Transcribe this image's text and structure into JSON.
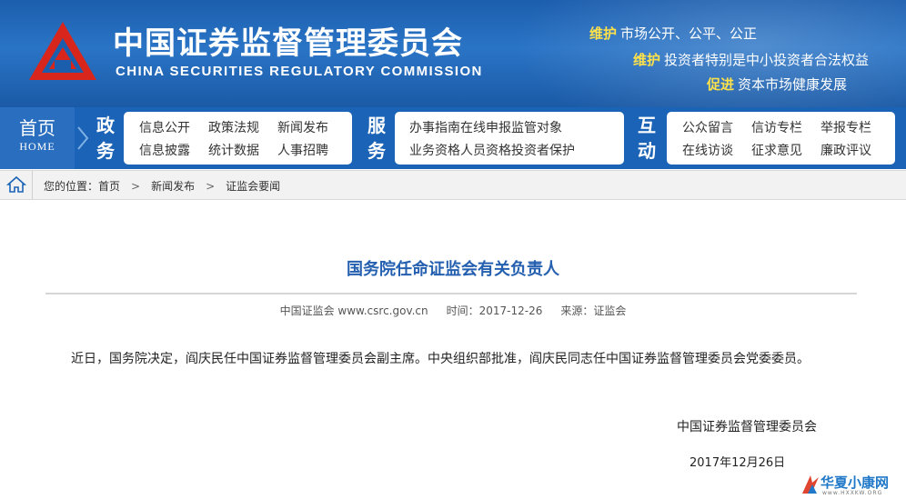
{
  "header": {
    "org_name_cn": "中国证券监督管理委员会",
    "org_name_en": "CHINA SECURITIES REGULATORY COMMISSION",
    "slogans": [
      {
        "highlight": "维护",
        "text": "市场公开、公平、公正"
      },
      {
        "highlight": "维护",
        "text": "投资者特别是中小投资者合法权益"
      },
      {
        "highlight": "促进",
        "text": "资本市场健康发展"
      }
    ]
  },
  "nav": {
    "home_cn": "首页",
    "home_en": "HOME",
    "sections": [
      {
        "title_1": "政",
        "title_2": "务",
        "row1": [
          "信息公开",
          "政策法规",
          "新闻发布"
        ],
        "row2": [
          "信息披露",
          "统计数据",
          "人事招聘"
        ]
      },
      {
        "title_1": "服",
        "title_2": "务",
        "row1": [
          "办事指南",
          "在线申报",
          "监管对象"
        ],
        "row2": [
          "业务资格",
          "人员资格",
          "投资者保护"
        ]
      },
      {
        "title_1": "互",
        "title_2": "动",
        "row1": [
          "公众留言",
          "信访专栏",
          "举报专栏"
        ],
        "row2": [
          "在线访谈",
          "征求意见",
          "廉政评议"
        ]
      }
    ]
  },
  "breadcrumb": {
    "prefix": "您的位置：",
    "items": [
      "首页",
      "新闻发布",
      "证监会要闻"
    ]
  },
  "article": {
    "title": "国务院任命证监会有关负责人",
    "source": "中国证监会 www.csrc.gov.cn",
    "time": "时间：2017-12-26",
    "origin": "来源：证监会",
    "body": "近日，国务院决定，阎庆民任中国证券监督管理委员会副主席。中央组织部批准，阎庆民同志任中国证券监督管理委员会党委委员。",
    "signature_org": "中国证券监督管理委员会",
    "signature_date": "2017年12月26日"
  },
  "watermark": {
    "title": "华夏小康网",
    "url": "www.HXXKW.ORG"
  },
  "colors": {
    "banner_blue": "#1c5eae",
    "nav_blue": "#1b63b6",
    "slogan_highlight": "#ffe24a",
    "title_blue": "#2560b0",
    "logo_red": "#d8261d"
  }
}
